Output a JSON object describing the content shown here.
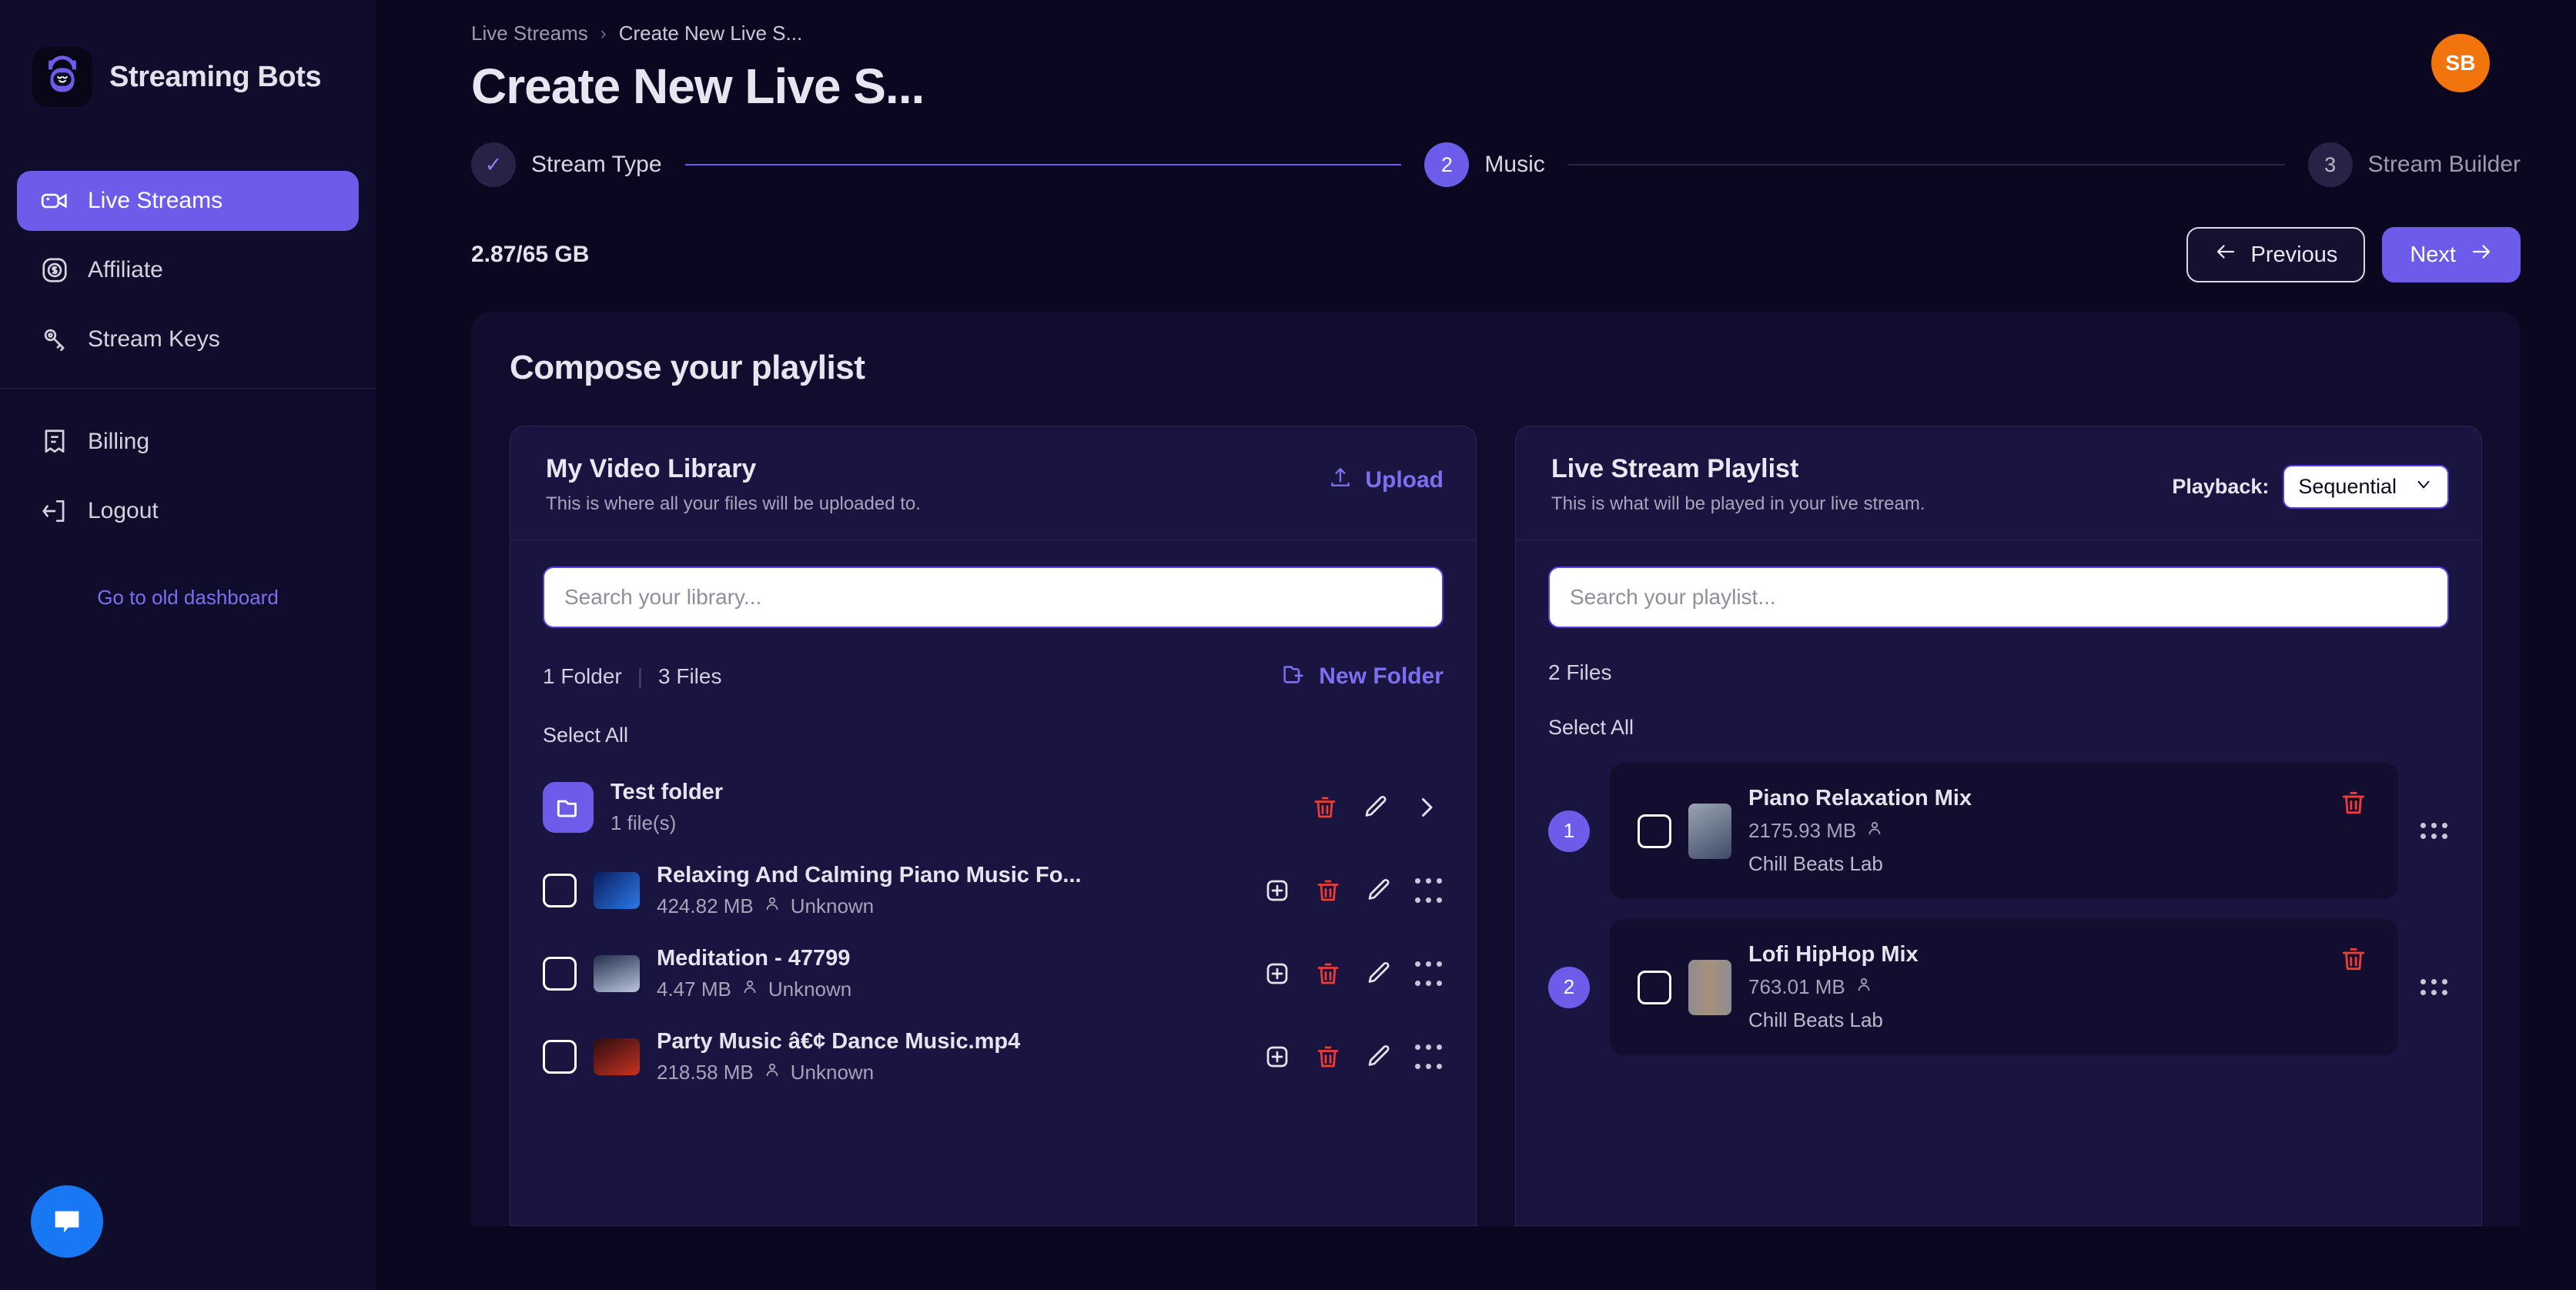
{
  "brand": {
    "name": "Streaming Bots",
    "logo_icon": "bot-logo-icon"
  },
  "sidebar": {
    "items": [
      {
        "label": "Live Streams",
        "icon": "video-camera-icon",
        "active": true
      },
      {
        "label": "Affiliate",
        "icon": "dollar-badge-icon",
        "active": false
      },
      {
        "label": "Stream Keys",
        "icon": "key-icon",
        "active": false
      }
    ],
    "lower_items": [
      {
        "label": "Billing",
        "icon": "receipt-icon"
      },
      {
        "label": "Logout",
        "icon": "logout-arrow-icon"
      }
    ],
    "old_dashboard_link": "Go to old dashboard",
    "chat_icon": "chat-bubble-icon"
  },
  "header": {
    "breadcrumb_root": "Live Streams",
    "breadcrumb_separator": "›",
    "breadcrumb_current": "Create New Live S...",
    "title": "Create New Live S...",
    "avatar_initials": "SB",
    "avatar_color": "#f2740c"
  },
  "stepper": {
    "steps": [
      {
        "badge": "✓",
        "label": "Stream Type",
        "state": "done"
      },
      {
        "badge": "2",
        "label": "Music",
        "state": "active"
      },
      {
        "badge": "3",
        "label": "Stream Builder",
        "state": "idle"
      }
    ]
  },
  "actions": {
    "storage": "2.87/65 GB",
    "previous_label": "Previous",
    "previous_icon": "arrow-left-icon",
    "next_label": "Next",
    "next_icon": "arrow-right-icon"
  },
  "compose": {
    "title": "Compose your playlist",
    "library": {
      "title": "My Video Library",
      "subtitle": "This is where all your files will be uploaded to.",
      "upload_label": "Upload",
      "upload_icon": "upload-icon",
      "search_placeholder": "Search your library...",
      "search_value": "",
      "folder_count": "1 Folder",
      "count_divider": "|",
      "file_count": "3 Files",
      "new_folder_label": "New Folder",
      "new_folder_icon": "folder-plus-icon",
      "select_all_label": "Select All",
      "folders": [
        {
          "name": "Test folder",
          "meta": "1 file(s)",
          "icon": "folder-icon",
          "actions": [
            "trash-icon",
            "pencil-icon",
            "chevron-right-icon"
          ]
        }
      ],
      "files": [
        {
          "name": "Relaxing And Calming Piano Music Fo...",
          "size": "424.82 MB",
          "owner": "Unknown",
          "thumb_colors": [
            "#0b1c5e",
            "#2a7ae8"
          ],
          "actions": [
            "plus-square-icon",
            "trash-icon",
            "pencil-icon",
            "drag-handle-icon"
          ]
        },
        {
          "name": "Meditation - 47799",
          "size": "4.47 MB",
          "owner": "Unknown",
          "thumb_colors": [
            "#24304f",
            "#b9c6da"
          ],
          "actions": [
            "plus-square-icon",
            "trash-icon",
            "pencil-icon",
            "drag-handle-icon"
          ]
        },
        {
          "name": "Party Music â€¢ Dance Music.mp4",
          "size": "218.58 MB",
          "owner": "Unknown",
          "thumb_colors": [
            "#2a0d12",
            "#c8321f"
          ],
          "actions": [
            "plus-square-icon",
            "trash-icon",
            "pencil-icon",
            "drag-handle-icon"
          ]
        }
      ]
    },
    "playlist": {
      "title": "Live Stream Playlist",
      "subtitle": "This is what will be played in your live stream.",
      "playback_label": "Playback:",
      "playback_value": "Sequential",
      "playback_chevron": "chevron-down-icon",
      "search_placeholder": "Search your playlist...",
      "search_value": "",
      "file_count": "2 Files",
      "select_all_label": "Select All",
      "items": [
        {
          "index": "1",
          "name": "Piano Relaxation Mix",
          "size": "2175.93 MB",
          "artist": "Chill Beats Lab",
          "thumb_colors": [
            "#7f8a97",
            "#3f4a66"
          ],
          "delete_icon": "trash-icon",
          "drag_icon": "drag-handle-icon"
        },
        {
          "index": "2",
          "name": "Lofi HipHop Mix",
          "size": "763.01 MB",
          "artist": "Chill Beats Lab",
          "thumb_colors": [
            "#a8907a",
            "#8e8e93"
          ],
          "delete_icon": "trash-icon",
          "drag_icon": "drag-handle-icon"
        }
      ]
    }
  },
  "colors": {
    "accent": "#6c5ce9",
    "accent_link": "#7c6ff0",
    "danger": "#ef3c36",
    "page_bg": "#0b0720",
    "sidebar_bg": "#100c2b",
    "panel_bg": "#1a1540",
    "card_bg": "#120d2e"
  }
}
